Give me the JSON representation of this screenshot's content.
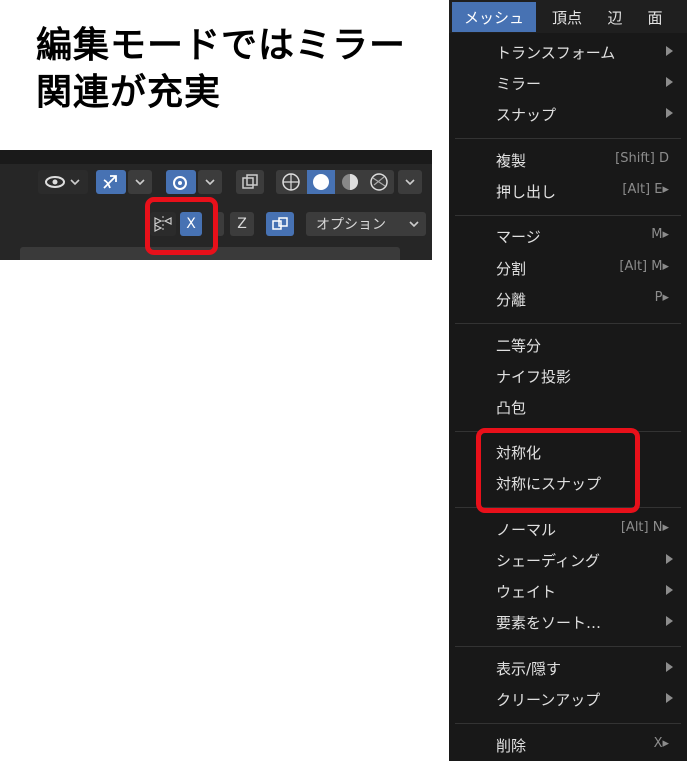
{
  "caption": {
    "line1": "編集モードではミラー",
    "line2": "関連が充実"
  },
  "header": {
    "axis_x": "X",
    "axis_z": "Z",
    "options_label": "オプション"
  },
  "menubar": {
    "items": [
      "メッシュ",
      "頂点",
      "辺",
      "面"
    ],
    "active": "メッシュ",
    "accent": "#4772b3"
  },
  "menu": {
    "items": [
      {
        "label": "トランスフォーム",
        "shortcut": "",
        "submenu": true
      },
      {
        "label": "ミラー",
        "shortcut": "",
        "submenu": true
      },
      {
        "label": "スナップ",
        "shortcut": "",
        "submenu": true
      },
      {
        "label": "複製",
        "shortcut": "[Shift] D",
        "submenu": false
      },
      {
        "label": "押し出し",
        "shortcut": "[Alt] E▸",
        "submenu": false
      },
      {
        "label": "マージ",
        "shortcut": "M▸",
        "submenu": false
      },
      {
        "label": "分割",
        "shortcut": "[Alt] M▸",
        "submenu": false
      },
      {
        "label": "分離",
        "shortcut": "P▸",
        "submenu": false
      },
      {
        "label": "二等分",
        "shortcut": "",
        "submenu": false
      },
      {
        "label": "ナイフ投影",
        "shortcut": "",
        "submenu": false
      },
      {
        "label": "凸包",
        "shortcut": "",
        "submenu": false
      },
      {
        "label": "対称化",
        "shortcut": "",
        "submenu": false
      },
      {
        "label": "対称にスナップ",
        "shortcut": "",
        "submenu": false
      },
      {
        "label": "ノーマル",
        "shortcut": "[Alt] N▸",
        "submenu": false
      },
      {
        "label": "シェーディング",
        "shortcut": "",
        "submenu": true
      },
      {
        "label": "ウェイト",
        "shortcut": "",
        "submenu": true
      },
      {
        "label": "要素をソート…",
        "shortcut": "",
        "submenu": true
      },
      {
        "label": "表示/隠す",
        "shortcut": "",
        "submenu": true
      },
      {
        "label": "クリーンアップ",
        "shortcut": "",
        "submenu": true
      },
      {
        "label": "削除",
        "shortcut": "X▸",
        "submenu": false
      }
    ]
  },
  "highlight_color": "#e8101a"
}
